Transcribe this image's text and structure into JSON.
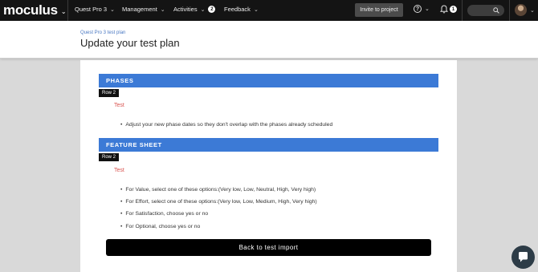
{
  "nav": {
    "logo": "moculus",
    "items": [
      {
        "label": "Quest Pro 3"
      },
      {
        "label": "Management"
      },
      {
        "label": "Activities",
        "count": "2"
      },
      {
        "label": "Feedback"
      }
    ],
    "invite_label": "Invite to project",
    "notifications_count": "1"
  },
  "header": {
    "breadcrumb": "Quest Pro 3 test plan",
    "title": "Update your test plan"
  },
  "sections": [
    {
      "title": "PHASES",
      "row_tag": "Row 2",
      "test_label": "Test",
      "bullets": [
        "Adjust your new phase dates so they don't overlap with the phases already scheduled"
      ]
    },
    {
      "title": "FEATURE SHEET",
      "row_tag": "Row 2",
      "test_label": "Test",
      "bullets": [
        "For Value, select one of these options:(Very low, Low, Neutral, High, Very high)",
        "For Effort, select one of these options:(Very low, Low, Medium, High, Very high)",
        "For Satisfaction, choose yes or no",
        "For Optional, choose yes or no"
      ]
    }
  ],
  "back_button_label": "Back to test import",
  "colors": {
    "section_bar": "#3c7ad6",
    "test_label": "#d9534f",
    "nav_bg": "#141414"
  }
}
